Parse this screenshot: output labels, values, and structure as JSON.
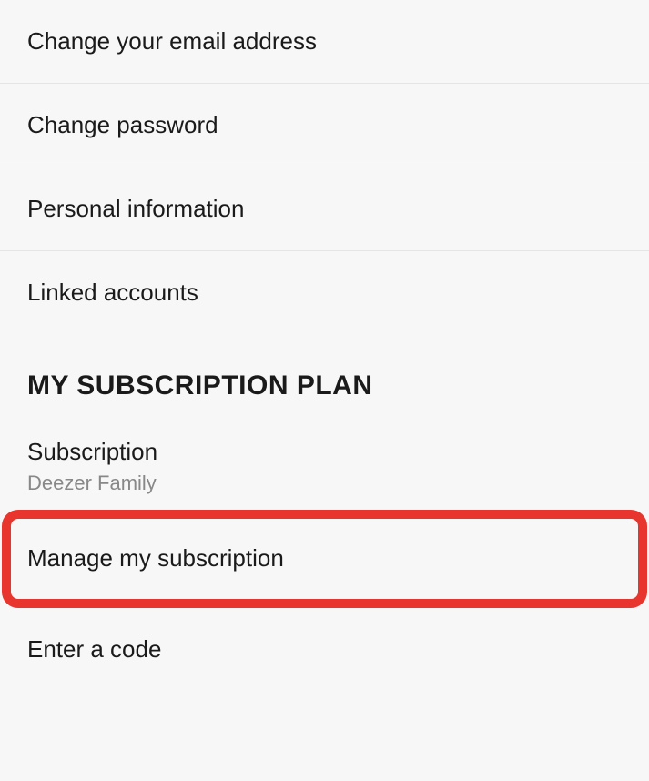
{
  "account": {
    "items": [
      {
        "label": "Change your email address"
      },
      {
        "label": "Change password"
      },
      {
        "label": "Personal information"
      },
      {
        "label": "Linked accounts"
      }
    ]
  },
  "subscription": {
    "header": "MY SUBSCRIPTION PLAN",
    "plan_label": "Subscription",
    "plan_value": "Deezer Family",
    "manage_label": "Manage my subscription",
    "code_label": "Enter a code"
  }
}
